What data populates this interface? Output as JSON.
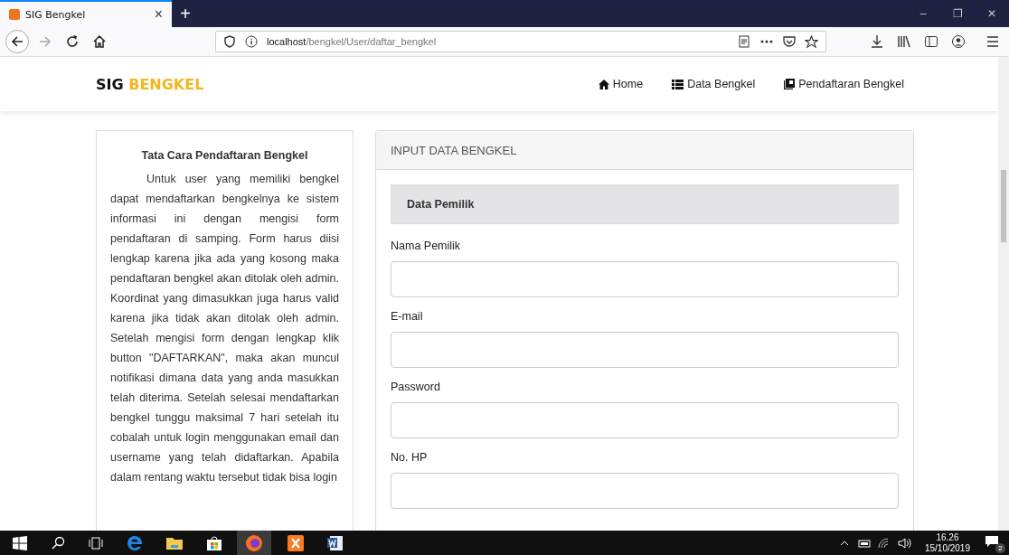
{
  "browser": {
    "tab": {
      "title": "SIG Bengkel",
      "close": "×"
    },
    "new_tab": "+",
    "window_controls": [
      "–",
      "❐",
      "✕"
    ],
    "url": {
      "host": "localhost",
      "path": "/bengkel/User/daftar_bengkel"
    }
  },
  "navbar": {
    "brand": {
      "part1": "SIG ",
      "part2": "BENGKEL"
    },
    "links": [
      {
        "label": "Home",
        "kind": "home"
      },
      {
        "label": "Data Bengkel",
        "kind": "list"
      },
      {
        "label": "Pendaftaran Bengkel",
        "kind": "book"
      }
    ]
  },
  "info_panel": {
    "title": "Tata Cara Pendaftaran Bengkel",
    "text": "Untuk user yang memiliki bengkel dapat mendaftarkan bengkelnya ke sistem informasi ini dengan mengisi form pendaftaran di samping. Form harus diisi lengkap karena jika ada yang kosong maka pendaftaran bengkel akan ditolak oleh admin. Koordinat yang dimasukkan juga harus valid karena jika tidak akan ditolak oleh admin. Setelah mengisi form dengan lengkap klik button \"DAFTARKAN\", maka akan muncul notifikasi dimana data yang anda masukkan telah diterima. Setelah selesai mendaftarkan bengkel tunggu maksimal 7 hari setelah itu cobalah untuk login menggunakan email dan username yang telah didaftarkan. Apabila dalam rentang waktu tersebut tidak bisa login"
  },
  "form_panel": {
    "title": "INPUT DATA BENGKEL",
    "section": "Data Pemilik",
    "fields": [
      {
        "label": "Nama Pemilik"
      },
      {
        "label": "E-mail"
      },
      {
        "label": "Password"
      },
      {
        "label": "No. HP"
      }
    ]
  },
  "taskbar": {
    "time": "16.26",
    "date": "15/10/2019",
    "notifications": "2"
  }
}
